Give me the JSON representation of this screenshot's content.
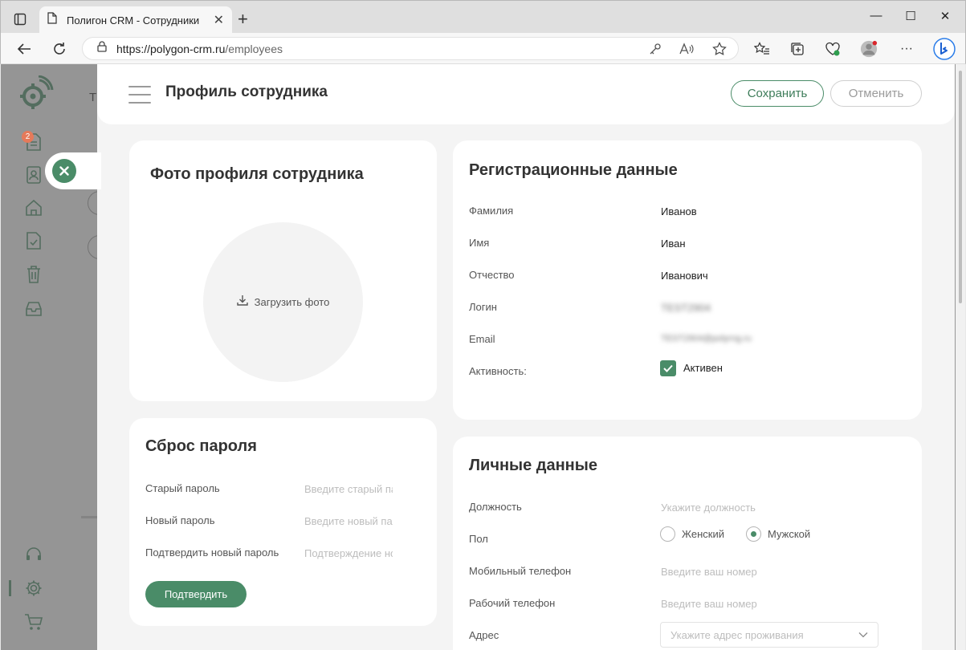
{
  "browser": {
    "tab_title": "Полигон CRM - Сотрудники",
    "url_host": "https://polygon-crm.ru",
    "url_path": "/employees"
  },
  "sidebar": {
    "badge_count": "2",
    "items": [
      {
        "icon": "document-icon"
      },
      {
        "icon": "user-card-icon"
      },
      {
        "icon": "home-icon"
      },
      {
        "icon": "checklist-icon"
      },
      {
        "icon": "trash-icon"
      },
      {
        "icon": "inbox-icon"
      },
      {
        "icon": "headset-icon"
      },
      {
        "icon": "gear-icon"
      },
      {
        "icon": "cart-icon"
      }
    ],
    "bg_letter": "Т"
  },
  "drawer": {
    "title": "Профиль сотрудника",
    "save_label": "Сохранить",
    "cancel_label": "Отменить"
  },
  "photo_card": {
    "title": "Фото профиля сотрудника",
    "upload_label": "Загрузить фото"
  },
  "password_card": {
    "title": "Сброс пароля",
    "rows": [
      {
        "label": "Старый пароль",
        "placeholder": "Введите старый пароль"
      },
      {
        "label": "Новый пароль",
        "placeholder": "Введите новый пароль"
      },
      {
        "label": "Подтвердить новый пароль",
        "placeholder": "Подтверждение нового пароля"
      }
    ],
    "confirm_label": "Подтвердить"
  },
  "registration_card": {
    "title": "Регистрационные данные",
    "rows": [
      {
        "label": "Фамилия",
        "value": "Иванов"
      },
      {
        "label": "Имя",
        "value": "Иван"
      },
      {
        "label": "Отчество",
        "value": "Иванович"
      },
      {
        "label": "Логин",
        "value": "TEST2904"
      },
      {
        "label": "Email",
        "value": "TEST2904@polyrng.ru"
      },
      {
        "label": "Активность:",
        "value": "Активен"
      }
    ]
  },
  "personal_card": {
    "title": "Личные данные",
    "position_label": "Должность",
    "position_placeholder": "Укажите должность",
    "gender_label": "Пол",
    "gender_options": [
      "Женский",
      "Мужской"
    ],
    "gender_selected": "Мужской",
    "mobile_label": "Мобильный телефон",
    "mobile_placeholder": "Введите ваш номер",
    "work_label": "Рабочий телефон",
    "work_placeholder": "Введите ваш номер",
    "address_label": "Адрес",
    "address_placeholder": "Укажите адрес проживания"
  },
  "colors": {
    "accent": "#4a8c68",
    "page_bg": "#f4f4f4"
  }
}
